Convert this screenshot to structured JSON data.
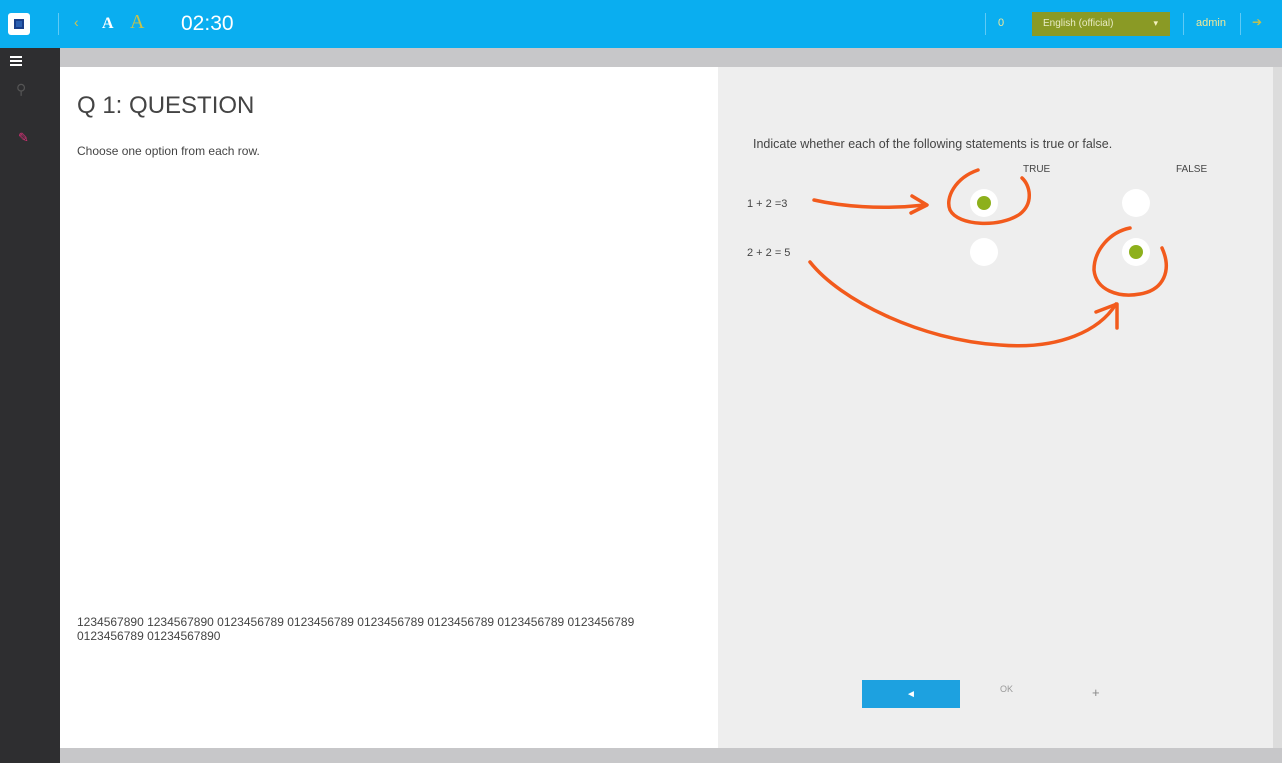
{
  "topbar": {
    "back_icon": "back-arrow-icon",
    "font_small_label": "A",
    "font_large_label": "A",
    "timer": "02:30",
    "count": "0",
    "language": "English (official)",
    "username": "admin",
    "colors": {
      "bar": "#0aaef0",
      "language_bg": "#8a9a25",
      "selected": "#8db01c",
      "annotation": "#f25a1c"
    }
  },
  "sidebar": {
    "items": [
      {
        "icon": "menu-icon"
      },
      {
        "icon": "key-icon"
      },
      {
        "icon": "pen-icon"
      }
    ]
  },
  "question": {
    "title": "Q 1: QUESTION",
    "instruction": "Choose one option from each row.",
    "footer_text": "1234567890 1234567890 0123456789 0123456789 0123456789 0123456789 0123456789 0123456789 0123456789 01234567890"
  },
  "answer": {
    "prompt": "Indicate whether each of the following statements is true or false.",
    "columns": [
      "TRUE",
      "FALSE"
    ],
    "rows": [
      {
        "label": "1 + 2 =3",
        "selected": "TRUE"
      },
      {
        "label": "2 + 2 = 5",
        "selected": "FALSE"
      }
    ]
  },
  "navigation": {
    "prev_icon": "◄",
    "middle_label": "OK",
    "next_icon": "+"
  }
}
